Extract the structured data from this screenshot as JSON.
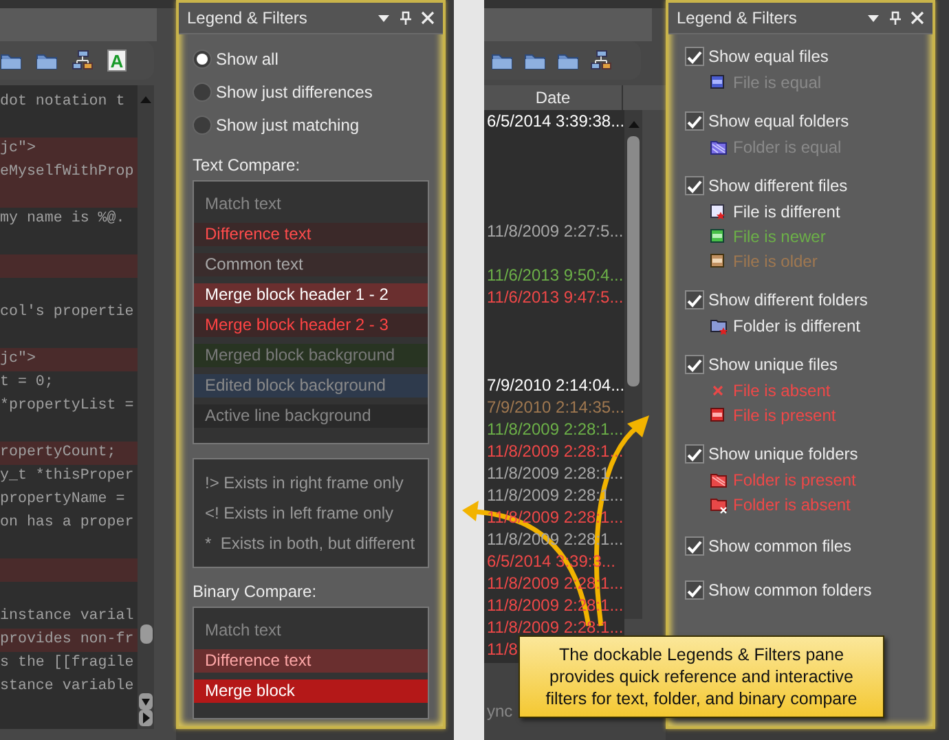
{
  "left_screen": {
    "toolbar_letter": "A",
    "editor": {
      "lines": [
        {
          "text": "dot notation t",
          "changed": false
        },
        {
          "changed": false
        },
        {
          "text": "jc\">",
          "changed": true
        },
        {
          "text": "eMyselfWithProp",
          "changed": true
        },
        {
          "changed": true
        },
        {
          "text": "my name is %@.",
          "changed": false
        },
        {
          "changed": false
        },
        {
          "changed": true
        },
        {
          "changed": false
        },
        {
          "text": "col's propertie",
          "changed": false
        },
        {
          "changed": false
        },
        {
          "text": "jc\">",
          "changed": true
        },
        {
          "text": "t = 0;",
          "changed": false
        },
        {
          "text": "*propertyList =",
          "changed": false
        },
        {
          "changed": false
        },
        {
          "text": "ropertyCount; ",
          "changed": true
        },
        {
          "text": "y_t *thisProper",
          "changed": false
        },
        {
          "text": "propertyName =",
          "changed": false
        },
        {
          "text": "on has a proper",
          "changed": false
        },
        {
          "changed": false
        },
        {
          "changed": true
        },
        {
          "changed": false
        },
        {
          "text": "instance varial",
          "changed": false
        },
        {
          "text": "provides non-fr",
          "changed": true
        },
        {
          "text": "s the [[fragile",
          "changed": false
        },
        {
          "text": "stance variable",
          "changed": false
        }
      ]
    },
    "pane": {
      "title": "Legend & Filters",
      "radios": [
        {
          "label": "Show all",
          "selected": true
        },
        {
          "label": "Show just differences",
          "selected": false
        },
        {
          "label": "Show just matching",
          "selected": false
        }
      ],
      "text_compare": {
        "heading": "Text Compare:",
        "items": [
          {
            "label": "Match text",
            "kind": "match"
          },
          {
            "label": "Difference text",
            "kind": "difference"
          },
          {
            "label": "Common text",
            "kind": "common"
          },
          {
            "label": "Merge block header 1 - 2",
            "kind": "merge_header_12"
          },
          {
            "label": "Merge block header 2 - 3",
            "kind": "merge_header_23"
          },
          {
            "label": "Merged block background",
            "kind": "merged"
          },
          {
            "label": "Edited block background",
            "kind": "edited"
          },
          {
            "label": "Active line background",
            "kind": "active_line"
          }
        ]
      },
      "markers": [
        "!> Exists in right frame only",
        "<! Exists in left frame only",
        "*  Exists in both, but different"
      ],
      "binary_compare": {
        "heading": "Binary Compare:",
        "items": [
          {
            "label": "Match text",
            "kind": "match"
          },
          {
            "label": "Difference text",
            "kind": "difference_block"
          },
          {
            "label": "Merge block",
            "kind": "merge_block"
          }
        ]
      }
    }
  },
  "right_screen": {
    "file_list": {
      "column": "Date",
      "rows": [
        {
          "kind": "date",
          "text": "6/5/2014 3:39:38...",
          "color": "#ffffff"
        },
        {
          "kind": "empty"
        },
        {
          "kind": "empty"
        },
        {
          "kind": "empty"
        },
        {
          "kind": "empty"
        },
        {
          "kind": "date",
          "text": "11/8/2009 2:27:5...",
          "color": "#a8a8a8"
        },
        {
          "kind": "empty"
        },
        {
          "kind": "date",
          "text": "11/6/2013 9:50:4...",
          "color": "#6cb048"
        },
        {
          "kind": "date",
          "text": "11/6/2013 9:47:5...",
          "color": "#f04848"
        },
        {
          "kind": "empty"
        },
        {
          "kind": "empty"
        },
        {
          "kind": "empty"
        },
        {
          "kind": "date",
          "text": "7/9/2010 2:14:04...",
          "color": "#ffffff"
        },
        {
          "kind": "date",
          "text": "7/9/2010 2:14:35...",
          "color": "#a07850"
        },
        {
          "kind": "date",
          "text": "11/8/2009 2:28:1...",
          "color": "#6cb048"
        },
        {
          "kind": "date",
          "text": "11/8/2009 2:28:1...",
          "color": "#f04848"
        },
        {
          "kind": "date",
          "text": "11/8/2009 2:28:1...",
          "color": "#a8a8a8"
        },
        {
          "kind": "date",
          "text": "11/8/2009 2:28:1...",
          "color": "#a8a8a8"
        },
        {
          "kind": "date",
          "text": "11/8/2009 2:28:1...",
          "color": "#f04848"
        },
        {
          "kind": "date",
          "text": "11/8/2009 2:28:1...",
          "color": "#a8a8a8"
        },
        {
          "kind": "date",
          "text": "6/5/2014 3:39:3...",
          "color": "#f04848"
        },
        {
          "kind": "date",
          "text": "11/8/2009 2:28:1...",
          "color": "#f04848"
        },
        {
          "kind": "date",
          "text": "11/8/2009 2:28:1...",
          "color": "#f04848"
        },
        {
          "kind": "date",
          "text": "11/8/2009 2:28:1...",
          "color": "#f04848"
        },
        {
          "kind": "date",
          "text": "11/8",
          "color": "#f04848"
        }
      ]
    },
    "footer": "ync",
    "pane": {
      "title": "Legend & Filters",
      "filters": [
        {
          "label": "Show equal files",
          "checked": true,
          "legend": [
            {
              "label": "File is equal",
              "kind": "file_equal"
            }
          ]
        },
        {
          "label": "Show equal folders",
          "checked": true,
          "legend": [
            {
              "label": "Folder is equal",
              "kind": "folder_equal"
            }
          ]
        },
        {
          "label": "Show different files",
          "checked": true,
          "legend": [
            {
              "label": "File is different",
              "kind": "file_different"
            },
            {
              "label": "File is newer",
              "kind": "file_newer"
            },
            {
              "label": "File is older",
              "kind": "file_older"
            }
          ]
        },
        {
          "label": "Show different folders",
          "checked": true,
          "legend": [
            {
              "label": "Folder is different",
              "kind": "folder_different"
            }
          ]
        },
        {
          "label": "Show unique files",
          "checked": true,
          "legend": [
            {
              "label": "File is absent",
              "kind": "file_absent"
            },
            {
              "label": "File is present",
              "kind": "file_present"
            }
          ]
        },
        {
          "label": "Show unique folders",
          "checked": true,
          "legend": [
            {
              "label": "Folder is present",
              "kind": "folder_present"
            },
            {
              "label": "Folder is absent",
              "kind": "folder_absent"
            }
          ]
        },
        {
          "label": "Show common files",
          "checked": true
        },
        {
          "label": "Show common folders",
          "checked": true
        }
      ]
    }
  },
  "callout": {
    "lines": [
      "The dockable Legends & Filters pane",
      "provides quick reference and interactive",
      "filters for text, folder, and binary compare"
    ]
  }
}
